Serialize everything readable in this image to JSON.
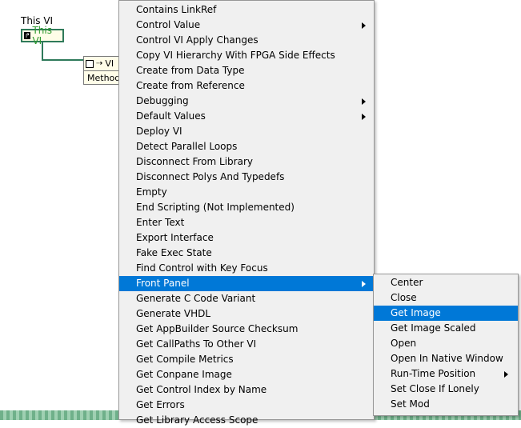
{
  "diagram": {
    "this_vi_label": "This VI",
    "this_vi_node_text": "This VI",
    "method_node_class": "VI",
    "method_node_label": "Method"
  },
  "main_menu": {
    "items": [
      {
        "label": "Contains LinkRef",
        "submenu": false
      },
      {
        "label": "Control Value",
        "submenu": true
      },
      {
        "label": "Control VI Apply Changes",
        "submenu": false
      },
      {
        "label": "Copy VI Hierarchy With FPGA Side Effects",
        "submenu": false
      },
      {
        "label": "Create from Data Type",
        "submenu": false
      },
      {
        "label": "Create from Reference",
        "submenu": false
      },
      {
        "label": "Debugging",
        "submenu": true
      },
      {
        "label": "Default Values",
        "submenu": true
      },
      {
        "label": "Deploy VI",
        "submenu": false
      },
      {
        "label": "Detect Parallel Loops",
        "submenu": false
      },
      {
        "label": "Disconnect From Library",
        "submenu": false
      },
      {
        "label": "Disconnect Polys And Typedefs",
        "submenu": false
      },
      {
        "label": "Empty",
        "submenu": false
      },
      {
        "label": "End Scripting (Not Implemented)",
        "submenu": false
      },
      {
        "label": "Enter Text",
        "submenu": false
      },
      {
        "label": "Export Interface",
        "submenu": false
      },
      {
        "label": "Fake Exec State",
        "submenu": false
      },
      {
        "label": "Find Control with Key Focus",
        "submenu": false
      },
      {
        "label": "Front Panel",
        "submenu": true,
        "active": true
      },
      {
        "label": "Generate C Code Variant",
        "submenu": false
      },
      {
        "label": "Generate VHDL",
        "submenu": false
      },
      {
        "label": "Get AppBuilder Source Checksum",
        "submenu": false
      },
      {
        "label": "Get CallPaths To Other VI",
        "submenu": false
      },
      {
        "label": "Get Compile Metrics",
        "submenu": false
      },
      {
        "label": "Get Conpane Image",
        "submenu": false
      },
      {
        "label": "Get Control Index by Name",
        "submenu": false
      },
      {
        "label": "Get Errors",
        "submenu": false
      },
      {
        "label": "Get Library Access Scope",
        "submenu": false
      }
    ]
  },
  "sub_menu": {
    "items": [
      {
        "label": "Center",
        "submenu": false
      },
      {
        "label": "Close",
        "submenu": false
      },
      {
        "label": "Get Image",
        "submenu": false,
        "active": true
      },
      {
        "label": "Get Image Scaled",
        "submenu": false
      },
      {
        "label": "Open",
        "submenu": false
      },
      {
        "label": "Open In Native Window",
        "submenu": false
      },
      {
        "label": "Run-Time Position",
        "submenu": true
      },
      {
        "label": "Set Close If Lonely",
        "submenu": false
      },
      {
        "label": "Set Mod",
        "submenu": false
      }
    ]
  },
  "colors": {
    "highlight": "#0078d7",
    "menu_bg": "#f0f0f0",
    "wire": "#2f7a5a"
  }
}
